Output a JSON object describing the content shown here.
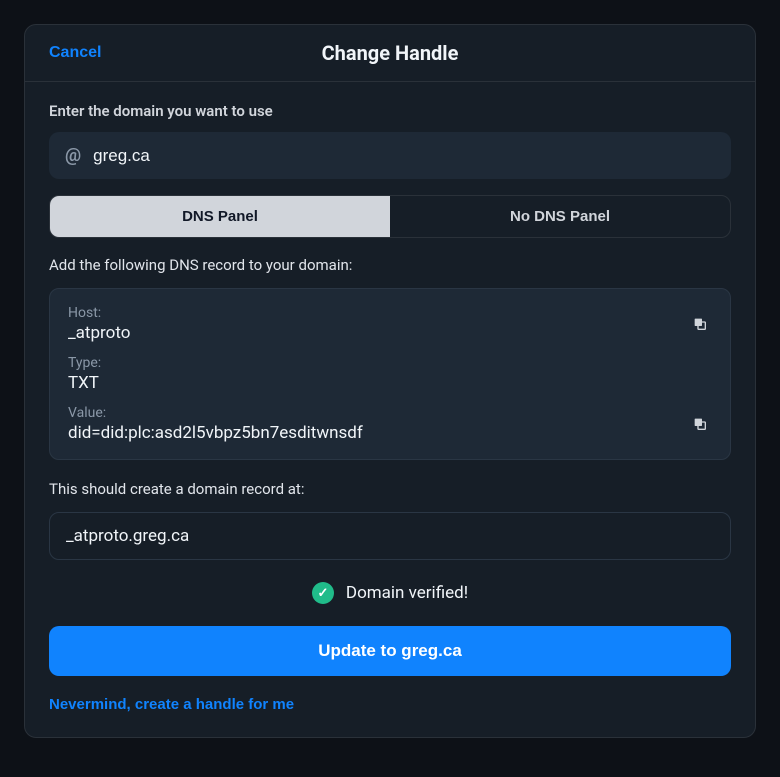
{
  "header": {
    "cancel": "Cancel",
    "title": "Change Handle"
  },
  "domain": {
    "label": "Enter the domain you want to use",
    "at_symbol": "@",
    "value": "greg.ca"
  },
  "tabs": {
    "dns": "DNS Panel",
    "no_dns": "No DNS Panel"
  },
  "dns_instruction": "Add the following DNS record to your domain:",
  "dns_record": {
    "host_label": "Host:",
    "host_value": "_atproto",
    "type_label": "Type:",
    "type_value": "TXT",
    "value_label": "Value:",
    "value_value": "did=did:plc:asd2l5vbpz5bn7esditwnsdf"
  },
  "record_result": {
    "label": "This should create a domain record at:",
    "value": "_atproto.greg.ca"
  },
  "verified": "Domain verified!",
  "update_button": "Update to greg.ca",
  "nevermind": "Nevermind, create a handle for me"
}
